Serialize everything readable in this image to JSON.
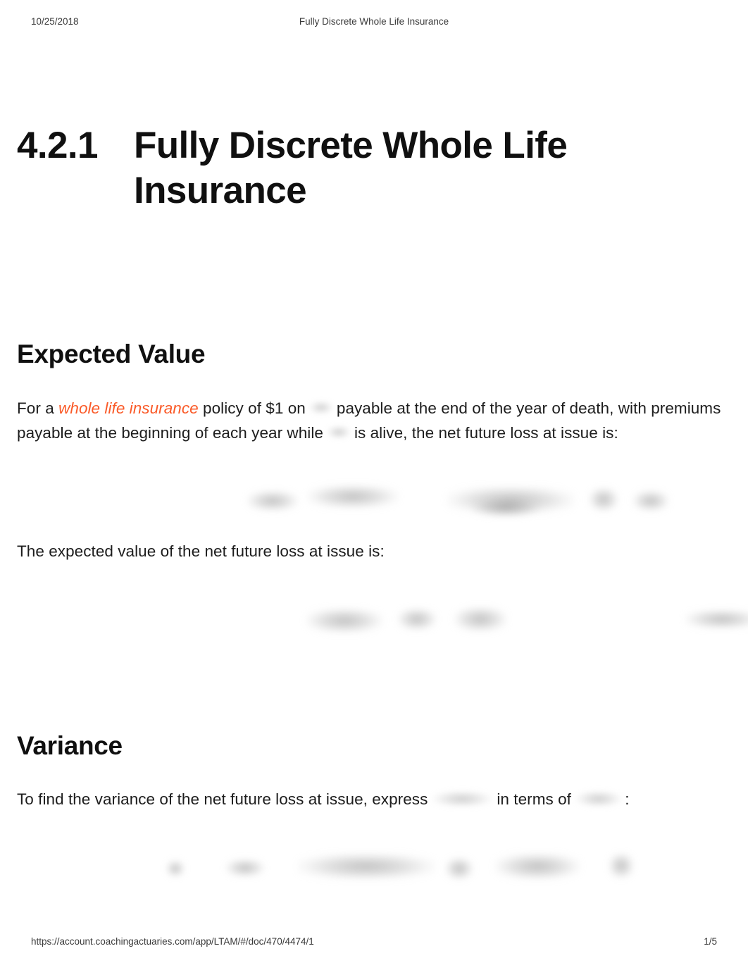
{
  "header": {
    "date": "10/25/2018",
    "title": "Fully Discrete Whole Life Insurance"
  },
  "document": {
    "section_number": "4.2.1",
    "section_title": "Fully Discrete Whole Life Insurance"
  },
  "sections": {
    "expected_value": {
      "heading": "Expected Value",
      "paragraph_1": {
        "before_link": "For a",
        "link_text": "whole life insurance",
        "after_link": "policy of $1 on",
        "middle": "payable at the end of the year of death, with premiums payable at the beginning of each year while",
        "end": "is alive, the net future loss at issue is:"
      },
      "paragraph_2": "The expected value of the net future loss at issue is:"
    },
    "variance": {
      "heading": "Variance",
      "paragraph_1": {
        "before": "To find the variance of the net future loss at issue, express",
        "middle": "in terms of",
        "after": ":"
      }
    }
  },
  "equations": {
    "eq1": "blurred-display-equation",
    "eq2": "blurred-display-equation",
    "eq2_tag": "blurred-equation-number",
    "eq3": "blurred-display-equation"
  },
  "footer": {
    "url": "https://account.coachingactuaries.com/app/LTAM/#/doc/470/4474/1",
    "page": "1/5"
  },
  "colors": {
    "link": "#fa5a28",
    "text": "#1d1d1d",
    "heading": "#101010",
    "background": "#ffffff"
  }
}
